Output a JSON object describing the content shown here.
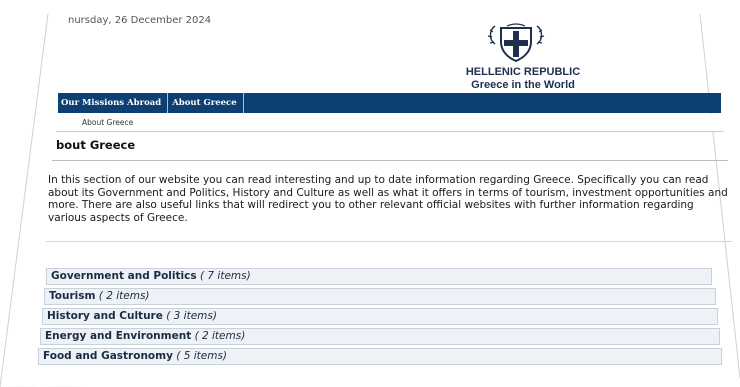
{
  "header": {
    "date": "nursday, 26 December 2024",
    "brand_line1": "HELLENIC REPUBLIC",
    "brand_line2": "Greece in the World",
    "emblem_icon": "greek-coat-of-arms-icon"
  },
  "nav": {
    "items": [
      {
        "label": "Our Missions Abroad"
      },
      {
        "label": "About Greece"
      }
    ]
  },
  "breadcrumb": {
    "current": "About Greece"
  },
  "page": {
    "title": "bout Greece",
    "intro": "In this section of our website you can read interesting and up to date information regarding Greece. Specifically you can read about its Government and Politics, History and Culture as well as what it offers in terms of tourism, investment opportunities and more.  There are also useful links that will redirect you to other relevant official websites with further information regarding various aspects of Greece."
  },
  "sections": [
    {
      "name": "Government and Politics",
      "count": "( 7 items)"
    },
    {
      "name": "Tourism",
      "count": "( 2 items)"
    },
    {
      "name": "History and Culture",
      "count": "( 3 items)"
    },
    {
      "name": "Energy and Environment",
      "count": "( 2 items)"
    },
    {
      "name": "Food and Gastronomy",
      "count": "( 5 items)"
    }
  ],
  "colors": {
    "nav_bg": "#0e3f73",
    "section_bg": "#eef1f5",
    "brand_text": "#1f2f4f"
  }
}
